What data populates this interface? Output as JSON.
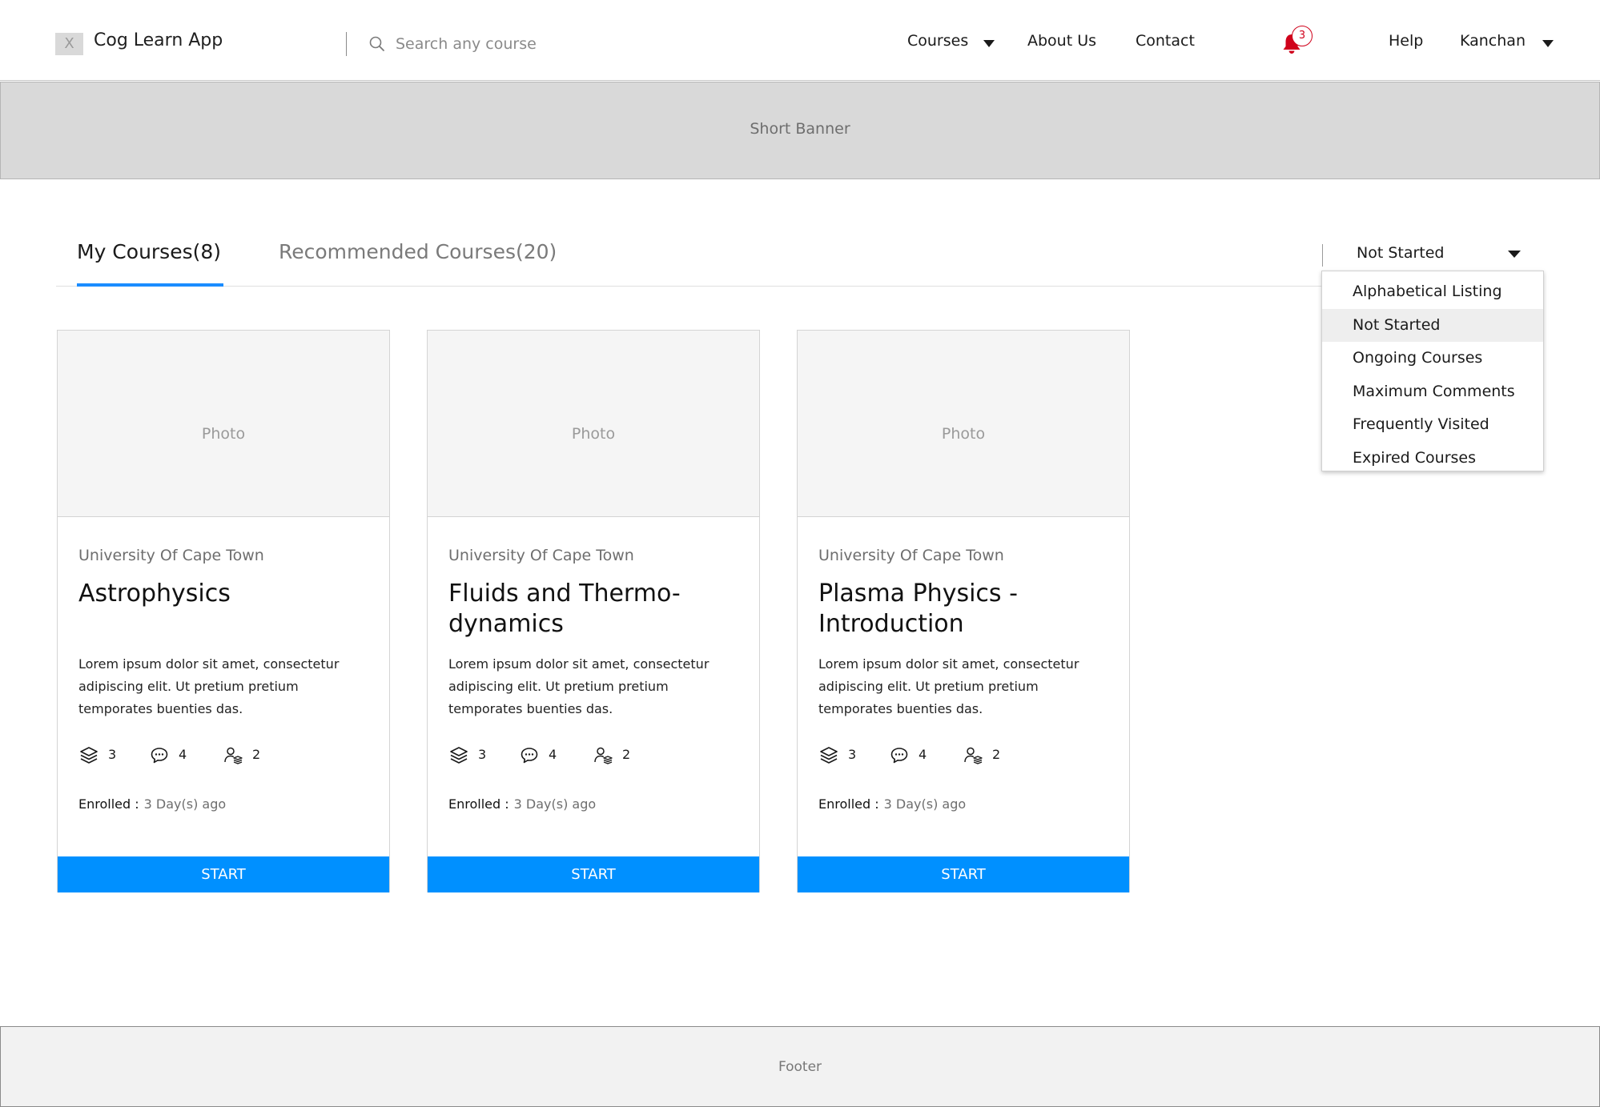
{
  "header": {
    "logo_glyph": "X",
    "app_title": "Cog Learn App",
    "search_placeholder": "Search any course",
    "nav": {
      "courses": "Courses",
      "about": "About Us",
      "contact": "Contact",
      "help": "Help",
      "user": "Kanchan"
    },
    "notification_count": "3",
    "notification_color": "#d0021b"
  },
  "banner": {
    "label": "Short Banner"
  },
  "tabs": [
    {
      "label": "My Courses(8)",
      "active": true
    },
    {
      "label": "Recommended Courses(20)",
      "active": false
    }
  ],
  "filter": {
    "selected": "Not Started",
    "options": [
      "Alphabetical Listing",
      "Not Started",
      "Ongoing Courses",
      "Maximum Comments",
      "Frequently Visited",
      "Expired Courses"
    ]
  },
  "cards": [
    {
      "photo_label": "Photo",
      "university": "University Of Cape Town",
      "title": "Astrophysics",
      "description": "Lorem ipsum dolor sit amet, consectetur adipiscing elit. Ut pretium pretium temporates buenties das.",
      "modules": "3",
      "comments": "4",
      "users": "2",
      "enrolled_label": "Enrolled :",
      "enrolled_value": "3 Day(s) ago",
      "button": "START"
    },
    {
      "photo_label": "Photo",
      "university": "University Of Cape Town",
      "title": "Fluids and Thermo-dynamics",
      "description": "Lorem ipsum dolor sit amet, consectetur adipiscing elit. Ut pretium pretium temporates buenties das.",
      "modules": "3",
      "comments": "4",
      "users": "2",
      "enrolled_label": "Enrolled :",
      "enrolled_value": "3 Day(s) ago",
      "button": "START"
    },
    {
      "photo_label": "Photo",
      "university": "University Of Cape Town",
      "title": "Plasma Physics - Introduction",
      "description": "Lorem ipsum dolor sit amet, consectetur adipiscing elit. Ut pretium pretium temporates buenties das.",
      "modules": "3",
      "comments": "4",
      "users": "2",
      "enrolled_label": "Enrolled :",
      "enrolled_value": "3 Day(s) ago",
      "button": "START"
    }
  ],
  "accent_color": "#0090ff",
  "footer": {
    "label": "Footer"
  }
}
